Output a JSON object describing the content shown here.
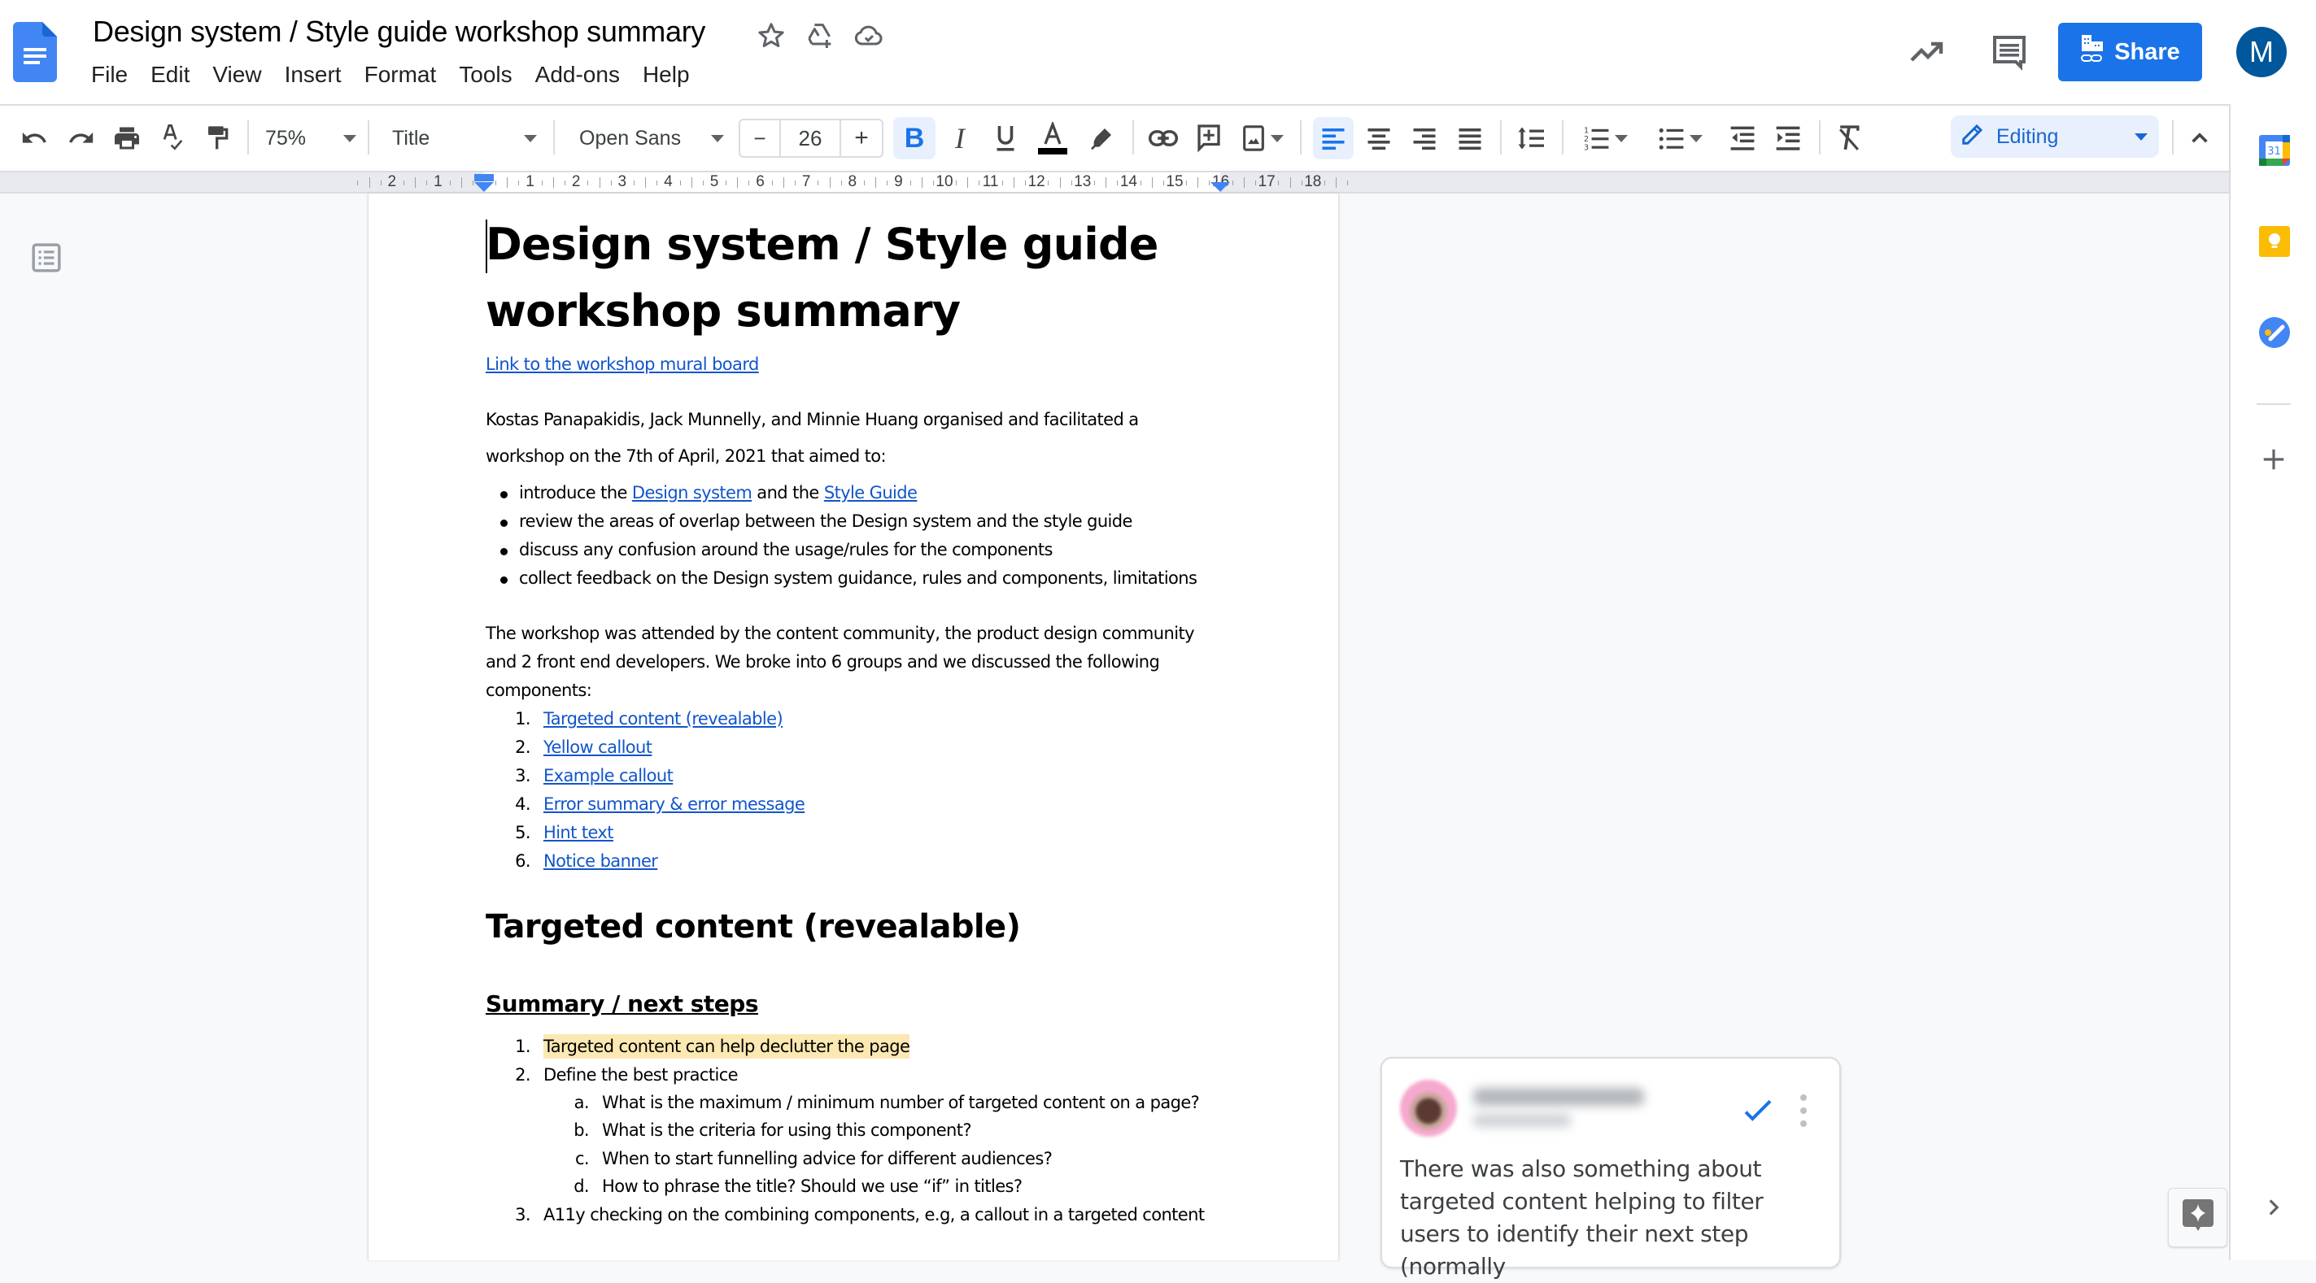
{
  "app": {
    "document_title": "Design system / Style guide workshop summary",
    "menu": [
      "File",
      "Edit",
      "View",
      "Insert",
      "Format",
      "Tools",
      "Add-ons",
      "Help"
    ],
    "share_label": "Share",
    "avatar_initial": "M",
    "icons": {
      "app_logo": "google-docs-icon",
      "star": "star-icon",
      "move_to_drive": "drive-add-icon",
      "saved_status": "cloud-done-icon",
      "activity": "trending-up-icon",
      "comments": "comment-history-icon",
      "share": "share-people-icon"
    }
  },
  "toolbar": {
    "zoom": "75%",
    "paragraph_style": "Title",
    "font_family": "Open Sans",
    "font_size": "26",
    "minus": "−",
    "plus": "+",
    "bold_active": true,
    "align_left_active": true,
    "mode_label": "Editing",
    "buttons": [
      "undo",
      "redo",
      "print",
      "spellcheck",
      "paint-format",
      "bold",
      "italic",
      "underline",
      "text-color",
      "highlight",
      "insert-link",
      "add-comment",
      "insert-image",
      "align-left",
      "align-center",
      "align-right",
      "justify",
      "line-spacing",
      "numbered-list",
      "bulleted-list",
      "decrease-indent",
      "increase-indent",
      "clear-formatting",
      "collapse-toolbar"
    ]
  },
  "ruler": {
    "left_numbers": [
      "2",
      "1"
    ],
    "right_numbers": [
      "1",
      "2",
      "3",
      "4",
      "5",
      "6",
      "7",
      "8",
      "9",
      "10",
      "11",
      "12",
      "13",
      "14",
      "15",
      "16",
      "17",
      "18"
    ],
    "accent_color": "#4285f4"
  },
  "document": {
    "title_line1": "Design system / Style guide",
    "title_line2": "workshop summary",
    "mural_link": "Link to the workshop mural board",
    "intro_line1": "Kostas Panapakidis, Jack Munnelly, and Minnie Huang organised and facilitated a",
    "intro_line2": "workshop on the 7th of April, 2021 that aimed to:",
    "aims": [
      {
        "prefix": "introduce the ",
        "link1": "Design system",
        "middle": " and the ",
        "link2": "Style Guide"
      },
      {
        "text": "review the areas of overlap between the Design system and the style guide"
      },
      {
        "text": "discuss any confusion around the usage/rules for the components"
      },
      {
        "text": "collect feedback on the Design system guidance, rules and components, limitations"
      }
    ],
    "attendance_line1": "The workshop was attended by the content community, the product design community",
    "attendance_line2": "and 2 front end developers. We broke into 6 groups and we discussed the following",
    "attendance_line3": "components:",
    "components": [
      {
        "num": "1.",
        "label": "Targeted content (revealable)"
      },
      {
        "num": "2.",
        "label": "Yellow callout"
      },
      {
        "num": "3.",
        "label": "Example callout"
      },
      {
        "num": "4.",
        "label": "Error summary & error message"
      },
      {
        "num": "5.",
        "label": "Hint text"
      },
      {
        "num": "6.",
        "label": "Notice banner"
      }
    ],
    "section_heading": "Targeted content (revealable)",
    "subheading": "Summary / next steps",
    "next_steps": [
      {
        "num": "1.",
        "text": "Targeted content can help declutter the page",
        "highlight": "#fce8b2"
      },
      {
        "num": "2.",
        "text": "Define the best practice"
      },
      {
        "num": "3.",
        "text": "A11y checking on the combining components, e.g, a callout in a targeted content"
      }
    ],
    "best_practice_sub": [
      {
        "num": "a.",
        "text": "What is the maximum / minimum number of targeted content on a page?"
      },
      {
        "num": "b.",
        "text": "What is the criteria for using this component?"
      },
      {
        "num": "c.",
        "text": "When to start funnelling advice for different audiences?"
      },
      {
        "num": "d.",
        "text": "How to phrase the title? Should we use “if” in titles?"
      }
    ]
  },
  "comment": {
    "author": "(blurred)",
    "time": "(blurred)",
    "text": "There was also something about targeted content helping to filter users to identify their next step (normally",
    "resolve_color": "#1a73e8"
  },
  "side_panel": {
    "apps": [
      "calendar-icon",
      "keep-icon",
      "tasks-icon"
    ],
    "calendar_day": "31",
    "add_label": "+"
  },
  "colors": {
    "brand_blue": "#1a73e8",
    "link": "#1155cc",
    "avatar": "#01579b",
    "highlight": "#fce8b2"
  }
}
